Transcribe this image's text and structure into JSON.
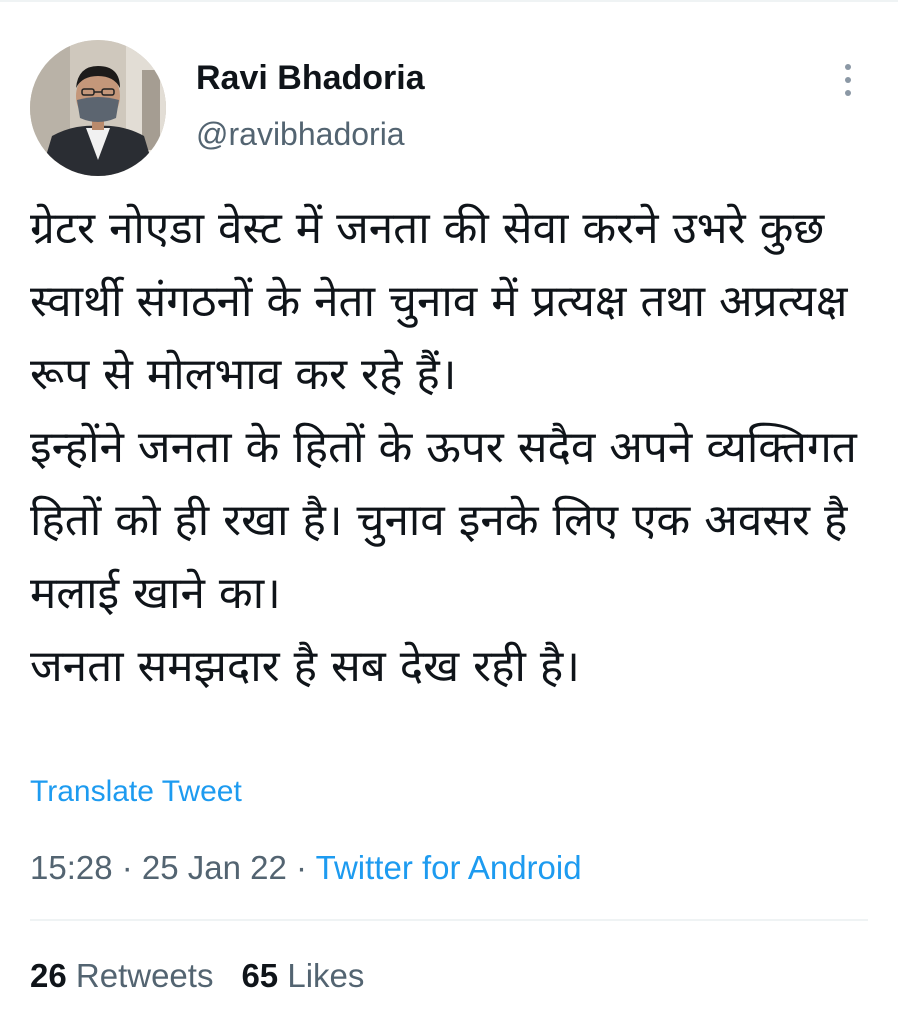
{
  "user": {
    "display_name": "Ravi Bhadoria",
    "handle": "@ravibhadoria"
  },
  "tweet": {
    "paragraphs": [
      "ग्रेटर नोएडा वेस्ट में जनता की सेवा करने उभरे कुछ स्वार्थी संगठनों के नेता चुनाव में प्रत्यक्ष तथा अप्रत्यक्ष रूप से मोलभाव कर रहे हैं।",
      "इन्होंने जनता के हितों के ऊपर सदैव अपने व्यक्तिगत हितों को ही रखा है। चुनाव इनके लिए एक अवसर है मलाई खाने का।",
      "जनता समझदार है सब देख रही है।"
    ],
    "translate_label": "Translate Tweet",
    "time": "15:28",
    "separator": " · ",
    "date": "25 Jan 22",
    "source": "Twitter for Android"
  },
  "stats": {
    "retweets_count": "26",
    "retweets_label": "Retweets",
    "likes_count": "65",
    "likes_label": "Likes"
  },
  "colors": {
    "accent": "#1d9bf0",
    "text_primary": "#0f1419",
    "text_secondary": "#536471",
    "divider": "#eff3f4"
  },
  "icons": {
    "more": "vertical-ellipsis-icon"
  }
}
